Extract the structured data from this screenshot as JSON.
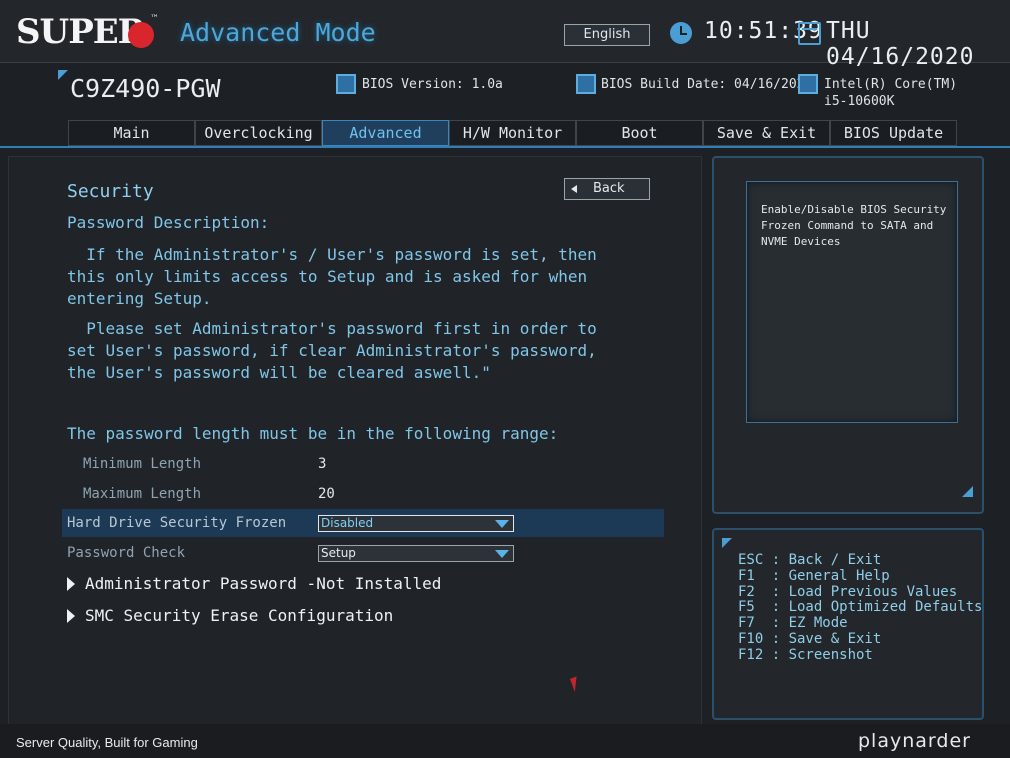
{
  "header": {
    "brand": "SUPER",
    "brand_tm": "™",
    "mode": "Advanced Mode",
    "language": "English",
    "time": "10:51:39",
    "date": "THU 04/16/2020"
  },
  "info": {
    "model": "C9Z490-PGW",
    "bios_version": "BIOS Version: 1.0a",
    "bios_build_date": "BIOS Build Date: 04/16/2020",
    "cpu_line1": "Intel(R) Core(TM)",
    "cpu_line2": "i5-10600K"
  },
  "tabs": [
    {
      "label": "Main"
    },
    {
      "label": "Overclocking"
    },
    {
      "label": "Advanced",
      "active": true
    },
    {
      "label": "H/W Monitor"
    },
    {
      "label": "Boot"
    },
    {
      "label": "Save & Exit"
    },
    {
      "label": "BIOS Update"
    }
  ],
  "main": {
    "title": "Security",
    "back_label": "Back",
    "desc_heading": "Password Description:",
    "para1": "  If the Administrator's / User's password is set, then\nthis only limits access to Setup and is asked for when\nentering Setup.",
    "para2": "  Please set Administrator's password first in order to\nset User's password, if clear Administrator's password,\nthe User's password will be cleared aswell.\"",
    "range_heading": "The password length must be in the following range:",
    "min_label": "Minimum Length",
    "min_value": "3",
    "max_label": "Maximum Length",
    "max_value": "20",
    "hdd_frozen_label": "Hard Drive Security Frozen",
    "hdd_frozen_value": "Disabled",
    "pw_check_label": "Password Check",
    "pw_check_value": "Setup",
    "admin_pw": "Administrator Password -Not Installed",
    "smc_erase": "SMC Security Erase Configuration"
  },
  "help": {
    "text": "Enable/Disable BIOS Security Frozen Command to SATA and NVME Devices"
  },
  "keys": [
    "ESC : Back / Exit",
    "F1  : General Help",
    "F2  : Load Previous Values",
    "F5  : Load Optimized Defaults",
    "F7  : EZ Mode",
    "F10 : Save & Exit",
    "F12 : Screenshot"
  ],
  "footer": {
    "slogan": "Server Quality, Built for Gaming",
    "watermark": "playnarder"
  },
  "colors": {
    "accent": "#4b9ed3",
    "brand_red": "#d8262c",
    "highlight_row": "#1c3a55"
  }
}
